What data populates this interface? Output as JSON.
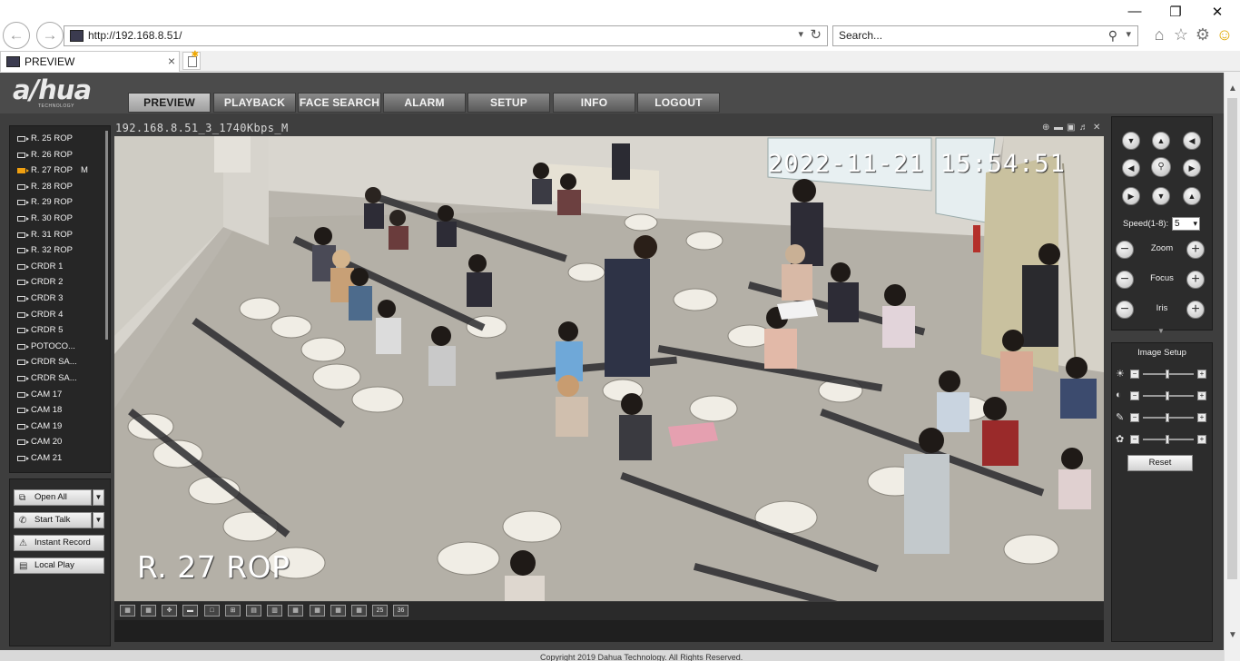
{
  "browser": {
    "url": "http://192.168.8.51/",
    "search_placeholder": "Search...",
    "tab_title": "PREVIEW"
  },
  "app": {
    "logo": "a/hua",
    "logo_sub": "TECHNOLOGY",
    "nav_tabs": [
      "PREVIEW",
      "PLAYBACK",
      "FACE SEARCH",
      "ALARM",
      "SETUP",
      "INFO",
      "LOGOUT"
    ],
    "active_tab": "PREVIEW",
    "channels": [
      {
        "label": "R. 25 ROP"
      },
      {
        "label": "R. 26 ROP"
      },
      {
        "label": "R. 27 ROP",
        "mark": "M",
        "live": true
      },
      {
        "label": "R. 28 ROP"
      },
      {
        "label": "R. 29 ROP"
      },
      {
        "label": "R. 30 ROP"
      },
      {
        "label": "R. 31 ROP"
      },
      {
        "label": "R. 32 ROP"
      },
      {
        "label": "CRDR 1"
      },
      {
        "label": "CRDR 2"
      },
      {
        "label": "CRDR 3"
      },
      {
        "label": "CRDR 4"
      },
      {
        "label": "CRDR 5"
      },
      {
        "label": "POTOCO..."
      },
      {
        "label": "CRDR SA..."
      },
      {
        "label": "CRDR SA..."
      },
      {
        "label": "CAM 17"
      },
      {
        "label": "CAM 18"
      },
      {
        "label": "CAM 19"
      },
      {
        "label": "CAM 20"
      },
      {
        "label": "CAM 21"
      }
    ],
    "controls": {
      "open_all": "Open All",
      "start_talk": "Start Talk",
      "instant_record": "Instant Record",
      "local_play": "Local Play"
    },
    "video": {
      "title": "192.168.8.51_3_1740Kbps_M",
      "osd_time": "2022-11-21 15:54:51",
      "osd_name": "R. 27 ROP"
    },
    "layout_buttons": [
      "",
      "",
      "",
      "",
      "",
      "",
      "",
      "",
      "",
      "",
      "",
      "",
      "25",
      "36"
    ],
    "ptz": {
      "speed_label": "Speed(1-8):",
      "speed_value": "5",
      "zoom_label": "Zoom",
      "focus_label": "Focus",
      "iris_label": "Iris"
    },
    "image_setup": {
      "title": "Image Setup",
      "reset": "Reset",
      "rows": [
        "brightness",
        "contrast",
        "saturation",
        "hue"
      ]
    },
    "footer_copy": "Copyright 2019 Dahua Technology. All Rights Reserved."
  }
}
